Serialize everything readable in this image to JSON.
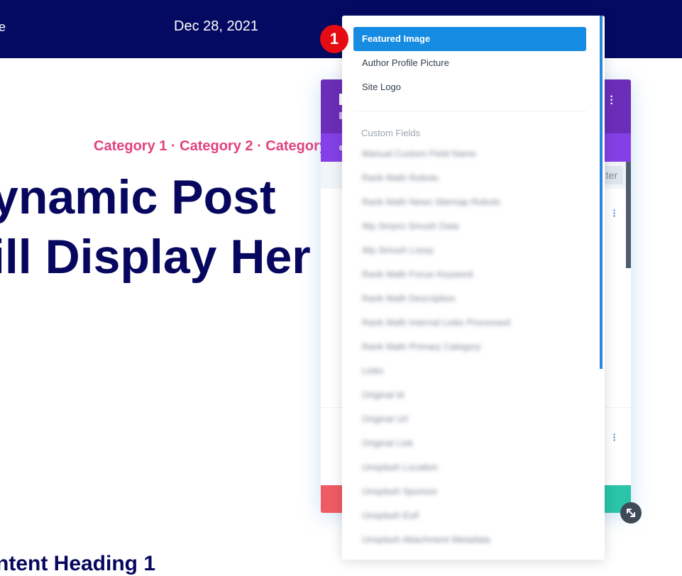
{
  "header": {
    "edge_text": "e",
    "date": "Dec 28, 2021"
  },
  "post": {
    "categories": "Category 1 · Category 2 · Category",
    "title_line1": "ynamic Post",
    "title_line2": "ill Display Her",
    "content_heading": "ntent Heading 1"
  },
  "modal": {
    "filter_label": "ter"
  },
  "dropdown": {
    "items": [
      "Featured Image",
      "Author Profile Picture",
      "Site Logo"
    ],
    "selected": "Featured Image",
    "group_label": "Custom Fields",
    "custom_fields": [
      "Manual Custom Field Name",
      "Rank Math Robots",
      "Rank Math News Sitemap Robots",
      "Wp Smpro Smush Data",
      "Wp Smush Lossy",
      "Rank Math Focus Keyword",
      "Rank Math Description",
      "Rank Math Internal Links Processed",
      "Rank Math Primary Category",
      "Links",
      "Original Id",
      "Original Url",
      "Original Link",
      "Unsplash Location",
      "Unsplash Sponsor",
      "Unsplash Exif",
      "Unsplash Attachment Metadata"
    ]
  },
  "annotation": {
    "step": "1"
  },
  "colors": {
    "nav_bg": "#040a61",
    "accent_pink": "#e2427d",
    "title_navy": "#07075f",
    "modal_purple": "#6c2eb9",
    "selection_blue": "#168be2",
    "badge_red": "#e60c14"
  },
  "icons": {
    "resize": "resize-arrows-icon",
    "menu": "kebab-menu-icon"
  }
}
